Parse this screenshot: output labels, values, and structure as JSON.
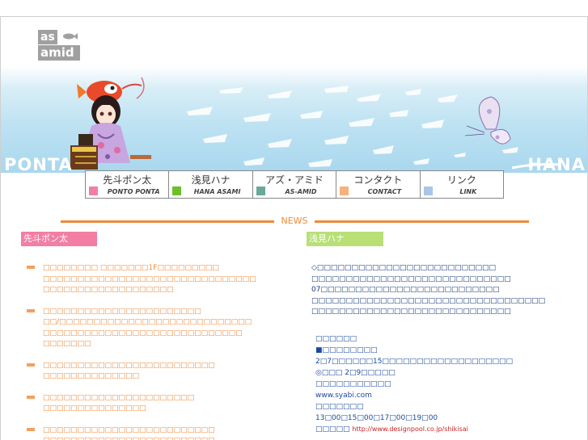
{
  "logo": {
    "line1": "as",
    "line2": "amid"
  },
  "banner": {
    "left_word": "PONTA",
    "right_word": "HANA"
  },
  "nav": {
    "items": [
      {
        "jp": "先斗ポン太",
        "en": "PONTO PONTA",
        "color": "#f37ea3"
      },
      {
        "jp": "浅見ハナ",
        "en": "HANA ASAMI",
        "color": "#6cc02a"
      },
      {
        "jp": "アズ・アミド",
        "en": "AS-AMID",
        "color": "#6aa89a"
      },
      {
        "jp": "コンタクト",
        "en": "CONTACT",
        "color": "#f7b27a"
      },
      {
        "jp": "リンク",
        "en": "LINK",
        "color": "#a9c6e6"
      }
    ]
  },
  "news": {
    "title": "NEWS"
  },
  "left_column": {
    "heading": "先斗ポン太",
    "items": [
      {
        "lines": [
          "□□□□□□□□ □□□□□□□1F□□□□□□□□□",
          "□□□□□□□□□□□□□□□□□□□□□□□□□□□□□□□",
          "□□□□□□□□□□□□□□□□□□□"
        ]
      },
      {
        "lines": [
          "□□□□□□□□□□□□□□□□□□□□□□□",
          "□□/□□□□□□□□□□□□□□□□□□□□□□□□□□□□",
          "□□□□□□□□□□□□□□□□□□□□□□□□□□□□□",
          "□□□□□□□"
        ]
      },
      {
        "lines": [
          "□□□□□□□□□□□□□□□□□□□□□□□□□",
          "□□□□□□□□□□□□□□"
        ]
      },
      {
        "lines": [
          "□□□□□□□□□□□□□□□□□□□□□□",
          "□□□□□□□□□□□□□□□"
        ]
      },
      {
        "lines": [
          "□□□□□□□□□□□□□□□□□□□□□□□□□",
          "□□□□□□□□□□□□□□□□□□□□□□□□□"
        ]
      }
    ]
  },
  "right_column": {
    "heading": "浅見ハナ",
    "lines": [
      "◇□□□□□□□□□□□□□□□□□□□□□□□□□□",
      "□□□□□□□□□□□□□□□□□□□□□□□□□□□□□",
      "07□□□□□□□□□□□□□□□□□□□□□□□□□□",
      "□□□□□□□□□□□□□□□□□□□□□□□□□□□□□□□□□□",
      "□□□□□□□□□□□□□□□□□□□□□□□□□□□□□"
    ],
    "info": {
      "line1": "□□□□□□",
      "line2": "■□□□□□□□□",
      "line3": "2□7□□□□□□15□□□□□□□□□□□□□□□□□□□",
      "line4": "◎□□□ 2□9□□□□□",
      "line5": "□□□□□□□□□□□",
      "line6": "www.syabi.com",
      "line7": "□□□□□□□",
      "line8": "13□00□15□00□17□00□19□00",
      "line9_label": "□□□□□",
      "line9_url": "http://www.designpool.co.jp/shikisai"
    }
  }
}
